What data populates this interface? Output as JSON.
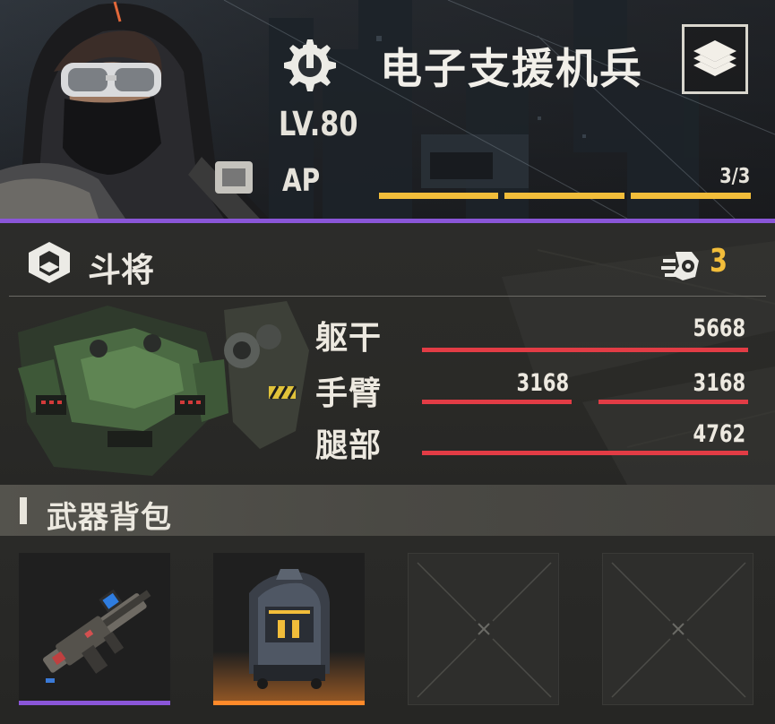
{
  "unit": {
    "name": "电子支援机兵",
    "level": "LV.80",
    "ap_label": "AP",
    "ap_value": "3/3",
    "ap_segments_filled": 3,
    "ap_segments_total": 3
  },
  "mech": {
    "class_name": "斗将",
    "speed_value": "3",
    "parts": [
      {
        "label": "躯干",
        "values": [
          "5668"
        ]
      },
      {
        "label": "手臂",
        "values": [
          "3168",
          "3168"
        ]
      },
      {
        "label": "腿部",
        "values": [
          "4762"
        ]
      }
    ]
  },
  "weapons": {
    "title": "武器背包",
    "slots": [
      {
        "type": "rifle",
        "rarity_color": "#8a56d8"
      },
      {
        "type": "backpack",
        "rarity_color": "#ff8a2a"
      },
      {
        "type": "empty"
      },
      {
        "type": "empty"
      }
    ]
  },
  "colors": {
    "accent_yellow": "#f2bd3a",
    "hp_red": "#e23c45",
    "header_purple": "#8a56d8",
    "legendary_orange": "#ff8a2a"
  },
  "icons": {
    "role": "wrench-gear-icon",
    "layers": "layers-icon",
    "class": "mech-class-icon",
    "speed": "speed-boot-icon"
  }
}
